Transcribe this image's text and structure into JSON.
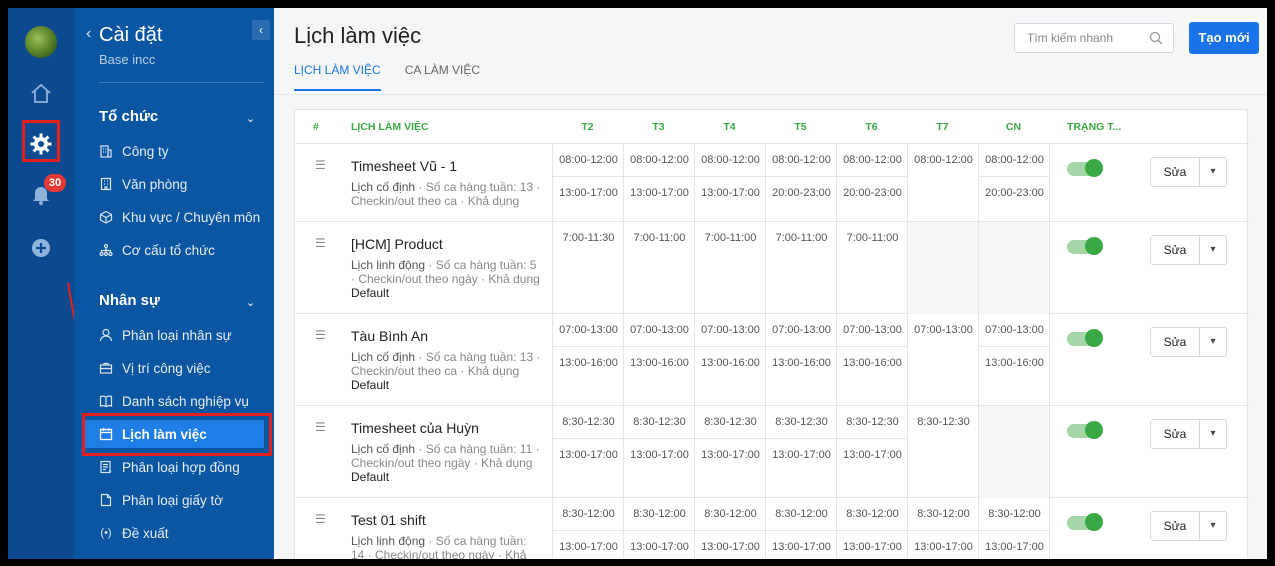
{
  "rail": {
    "badge_count": "30"
  },
  "sidebar": {
    "title": "Cài đặt",
    "subtitle": "Base incc",
    "sections": [
      {
        "label": "Tổ chức",
        "items": [
          {
            "label": "Công ty",
            "icon": "building-icon"
          },
          {
            "label": "Văn phòng",
            "icon": "office-icon"
          },
          {
            "label": "Khu vực / Chuyên môn",
            "icon": "cube-icon"
          },
          {
            "label": "Cơ cấu tổ chức",
            "icon": "org-chart-icon"
          }
        ]
      },
      {
        "label": "Nhân sự",
        "items": [
          {
            "label": "Phân loại nhân sự",
            "icon": "person-icon"
          },
          {
            "label": "Vị trí công việc",
            "icon": "briefcase-icon"
          },
          {
            "label": "Danh sách nghiệp vụ",
            "icon": "book-icon"
          },
          {
            "label": "Lịch làm việc",
            "icon": "calendar-icon",
            "active": true
          },
          {
            "label": "Phân loại hợp đồng",
            "icon": "contract-icon"
          },
          {
            "label": "Phân loại giấy tờ",
            "icon": "document-icon"
          },
          {
            "label": "Đề xuất",
            "icon": "broadcast-icon"
          }
        ]
      }
    ]
  },
  "main": {
    "title": "Lịch làm việc",
    "search_placeholder": "Tìm kiếm nhanh",
    "create_label": "Tạo mới",
    "tabs": [
      {
        "label": "LỊCH LÀM VIỆC",
        "active": true
      },
      {
        "label": "CA LÀM VIỆC",
        "active": false
      }
    ]
  },
  "table": {
    "headers": {
      "index": "#",
      "name": "LỊCH LÀM VIỆC",
      "days": [
        "T2",
        "T3",
        "T4",
        "T5",
        "T6",
        "T7",
        "CN"
      ],
      "status": "TRẠNG T..."
    },
    "edit_label": "Sửa",
    "rows": [
      {
        "name": "Timesheet Vũ - 1",
        "type": "Lịch cố định",
        "meta": " · Số ca hàng tuần: 13 · Checkin/out theo ca · Khả dụng",
        "default": "",
        "days": [
          [
            "08:00-12:00",
            "13:00-17:00"
          ],
          [
            "08:00-12:00",
            "13:00-17:00"
          ],
          [
            "08:00-12:00",
            "13:00-17:00"
          ],
          [
            "08:00-12:00",
            "20:00-23:00"
          ],
          [
            "08:00-12:00",
            "20:00-23:00"
          ],
          [
            "08:00-12:00"
          ],
          [
            "08:00-12:00",
            "20:00-23:00"
          ]
        ],
        "status_on": true
      },
      {
        "name": "[HCM] Product",
        "type": "Lịch linh động",
        "meta": " · Số ca hàng tuần: 5 · Checkin/out theo ngày · Khả dụng",
        "default": "Default",
        "days": [
          [
            "7:00-11:30"
          ],
          [
            "7:00-11:00"
          ],
          [
            "7:00-11:00"
          ],
          [
            "7:00-11:00"
          ],
          [
            "7:00-11:00"
          ],
          [],
          []
        ],
        "status_on": true
      },
      {
        "name": "Tàu Bình An",
        "type": "Lịch cố định",
        "meta": " · Số ca hàng tuần: 13 · Checkin/out theo ca · Khả dụng",
        "default": "Default",
        "days": [
          [
            "07:00-13:00",
            "13:00-16:00"
          ],
          [
            "07:00-13:00",
            "13:00-16:00"
          ],
          [
            "07:00-13:00",
            "13:00-16:00"
          ],
          [
            "07:00-13:00",
            "13:00-16:00"
          ],
          [
            "07:00-13:00",
            "13:00-16:00"
          ],
          [
            "07:00-13:00"
          ],
          [
            "07:00-13:00",
            "13:00-16:00"
          ]
        ],
        "status_on": true
      },
      {
        "name": "Timesheet của Huỳn",
        "type": "Lịch cố định",
        "meta": " · Số ca hàng tuần: 11 · Checkin/out theo ngày · Khả dụng",
        "default": "Default",
        "days": [
          [
            "8:30-12:30",
            "13:00-17:00"
          ],
          [
            "8:30-12:30",
            "13:00-17:00"
          ],
          [
            "8:30-12:30",
            "13:00-17:00"
          ],
          [
            "8:30-12:30",
            "13:00-17:00"
          ],
          [
            "8:30-12:30",
            "13:00-17:00"
          ],
          [
            "8:30-12:30"
          ],
          []
        ],
        "status_on": true
      },
      {
        "name": "Test 01 shift",
        "type": "Lịch linh động",
        "meta": " · Số ca hàng tuần: 14 · Checkin/out theo ngày · Khả",
        "default": "",
        "days": [
          [
            "8:30-12:00",
            "13:00-17:00"
          ],
          [
            "8:30-12:00",
            "13:00-17:00"
          ],
          [
            "8:30-12:00",
            "13:00-17:00"
          ],
          [
            "8:30-12:00",
            "13:00-17:00"
          ],
          [
            "8:30-12:00",
            "13:00-17:00"
          ],
          [
            "8:30-12:00",
            "13:00-17:00"
          ],
          [
            "8:30-12:00",
            "13:00-17:00"
          ]
        ],
        "status_on": true
      }
    ]
  },
  "colors": {
    "sidebar_bg": "#0b56a3",
    "rail_bg": "#0d4a8f",
    "accent": "#1a73e8",
    "header_green": "#3aa845",
    "highlight": "#e3201b"
  }
}
